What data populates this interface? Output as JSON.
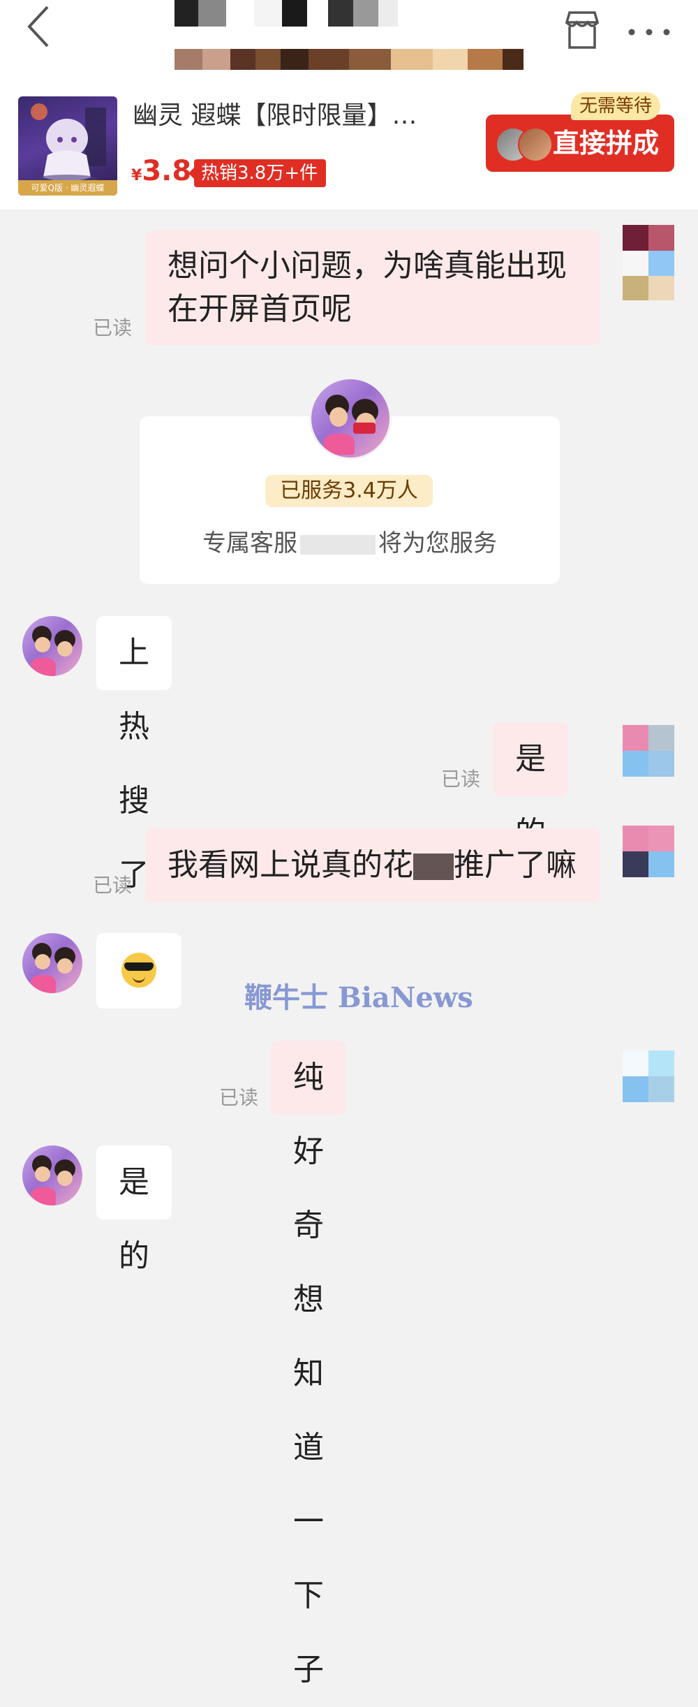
{
  "header": {
    "back_icon": "chevron-left-icon",
    "shop_icon": "store-icon",
    "more_icon": "more-horizontal-icon"
  },
  "product": {
    "thumb_caption": "可爱Q版 · 幽灵遐蝶",
    "title": "幽灵 遐蝶【限时限量】…",
    "price_currency": "¥",
    "price_value": "3.8",
    "sales_badge": "热销3.8万+件",
    "buy_label": "直接拼成",
    "no_wait_tag": "无需等待",
    "accent_color": "#e02e24"
  },
  "chat": {
    "read_label": "已读",
    "messages": [
      {
        "side": "out",
        "text_line1": "想问个小问题，为啥真能出现",
        "text_line2": "在开屏首页呢",
        "read": "已读"
      },
      {
        "side": "in",
        "text": "上热搜了"
      },
      {
        "side": "out",
        "text": "是的",
        "read": "已读"
      },
      {
        "side": "out",
        "text_prefix": "我看网上说真的花",
        "text_suffix": "推广了嘛",
        "read": "已读"
      },
      {
        "side": "in",
        "emoji": "sunglasses-emoji"
      },
      {
        "side": "out",
        "text": "纯好奇想知道一下子",
        "read": "已读"
      },
      {
        "side": "in",
        "text": "是的"
      }
    ]
  },
  "service_card": {
    "served_badge": "已服务3.4万人",
    "line_prefix": "专属客服",
    "line_suffix": "将为您服务"
  },
  "watermark": {
    "text": "鞭牛士 BiaNews"
  }
}
